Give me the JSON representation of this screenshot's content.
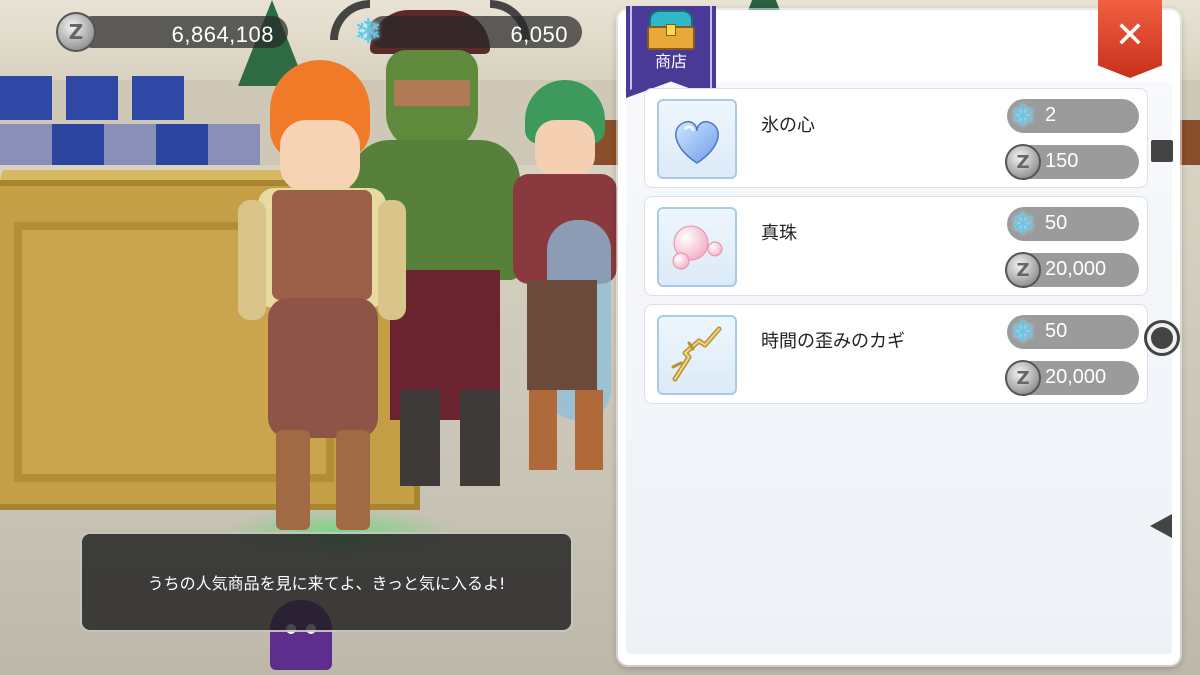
{
  "hud": {
    "zeny": {
      "icon": "zeny-coin-icon",
      "value": "6,864,108"
    },
    "crystals": {
      "icon": "snowflake-icon",
      "value": "6,050"
    }
  },
  "shop": {
    "title": "商店",
    "close_icon": "close-icon",
    "items": [
      {
        "name": "氷の心",
        "icon": "ice-heart-icon",
        "crystal_price": "2",
        "zeny_price": "150"
      },
      {
        "name": "真珠",
        "icon": "pearl-icon",
        "crystal_price": "50",
        "zeny_price": "20,000"
      },
      {
        "name": "時間の歪みのカギ",
        "icon": "twisted-key-icon",
        "crystal_price": "50",
        "zeny_price": "20,000"
      }
    ]
  },
  "dialog": {
    "text": "うちの人気商品を見に来てよ、きっと気に入るよ!"
  },
  "colors": {
    "shop_banner": "#4a3a98",
    "close_button": "#e0462c",
    "price_pill": "#9b9b9b",
    "crystal": "#5fc8e8"
  }
}
